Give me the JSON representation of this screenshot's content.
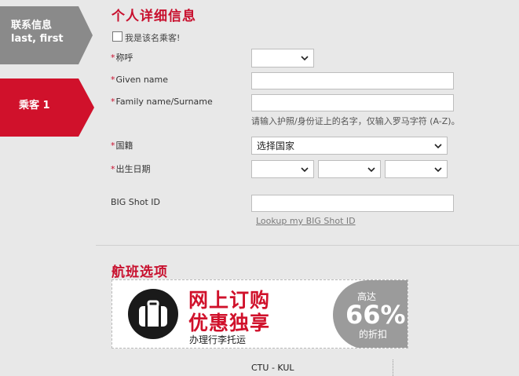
{
  "steps": [
    {
      "label": "联系信息",
      "sublabel": "last, first",
      "color": "#8a8a8a"
    },
    {
      "label": "乘客 1",
      "color": "#d0112b"
    }
  ],
  "personal": {
    "title": "个人详细信息",
    "self_checkbox_label": "我是该名乘客!",
    "salutation_label": "称呼",
    "given_name_label": "Given name",
    "family_name_label": "Family name/Surname",
    "name_hint": "请输入护照/身份证上的名字，仅输入罗马字符 (A-Z)。",
    "nationality_label": "国籍",
    "nationality_value": "选择国家",
    "dob_label": "出生日期",
    "bigshot_label": "BIG Shot ID",
    "lookup_link": "Lookup my BIG Shot ID"
  },
  "flight_options": {
    "title": "航班选项",
    "promo_line1": "网上订购",
    "promo_line2": "优惠独享",
    "promo_sub": "办理行李托运",
    "badge_top": "高达",
    "badge_percent": "66%",
    "badge_bottom": "的折扣",
    "route": "CTU - KUL"
  },
  "colors": {
    "accent": "#c8102e",
    "panel": "#e8e8e8",
    "step_inactive": "#8a8a8a"
  }
}
